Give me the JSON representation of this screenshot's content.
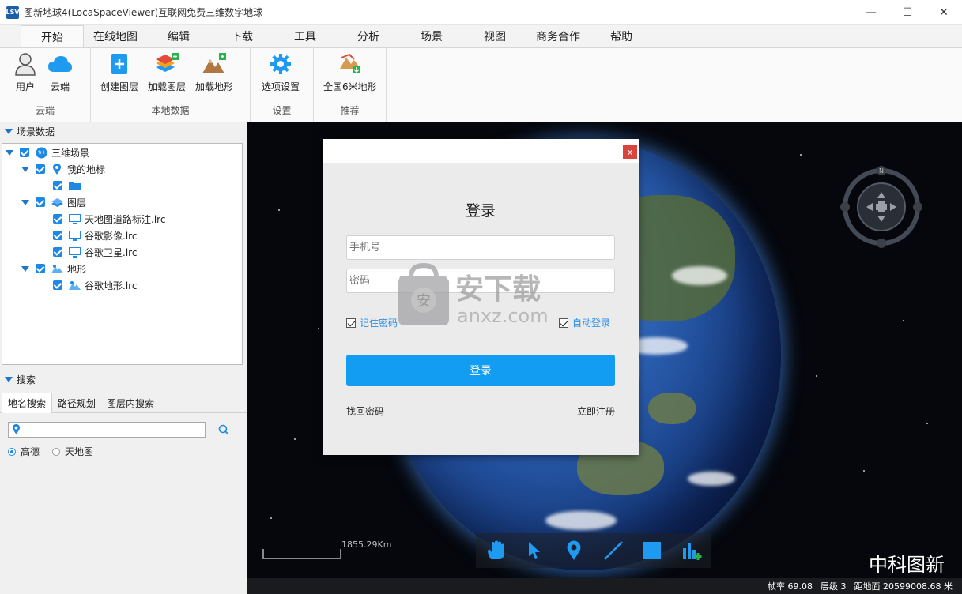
{
  "window": {
    "title": "图新地球4(LocaSpaceViewer)互联网免费三维数字地球",
    "app_icon_text": "LSV",
    "minimize": "—",
    "maximize": "☐",
    "close": "✕"
  },
  "menu": {
    "tabs": [
      "开始",
      "在线地图",
      "编辑",
      "下载",
      "工具",
      "分析",
      "场景",
      "视图",
      "商务合作",
      "帮助"
    ],
    "active": "开始"
  },
  "ribbon": {
    "groups": [
      {
        "label": "云端",
        "items": [
          {
            "label": "用户",
            "icon": "user-icon"
          },
          {
            "label": "云端",
            "icon": "cloud-icon"
          }
        ]
      },
      {
        "label": "本地数据",
        "items": [
          {
            "label": "创建图层",
            "icon": "create-layer-icon"
          },
          {
            "label": "加载图层",
            "icon": "load-layer-icon"
          },
          {
            "label": "加载地形",
            "icon": "load-terrain-icon"
          }
        ]
      },
      {
        "label": "设置",
        "items": [
          {
            "label": "选项设置",
            "icon": "gear-icon"
          }
        ]
      },
      {
        "label": "推荐",
        "items": [
          {
            "label": "全国6米地形",
            "icon": "terrain-6m-icon"
          }
        ]
      }
    ]
  },
  "scene_panel": {
    "header": "场景数据",
    "tree": [
      {
        "label": "三维场景",
        "icon": "globe-icon",
        "level": 0
      },
      {
        "label": "我的地标",
        "icon": "pin-icon",
        "level": 1
      },
      {
        "label": "",
        "icon": "folder-icon",
        "level": 2
      },
      {
        "label": "图层",
        "icon": "layers-icon",
        "level": 1
      },
      {
        "label": "天地图道路标注.lrc",
        "icon": "monitor-icon",
        "level": 2
      },
      {
        "label": "谷歌影像.lrc",
        "icon": "monitor-icon",
        "level": 2
      },
      {
        "label": "谷歌卫星.lrc",
        "icon": "monitor-icon",
        "level": 2
      },
      {
        "label": "地形",
        "icon": "terrain-icon",
        "level": 1
      },
      {
        "label": "谷歌地形.lrc",
        "icon": "terrain-icon",
        "level": 2
      }
    ]
  },
  "search_panel": {
    "header": "搜索",
    "tabs": [
      "地名搜索",
      "路径规划",
      "图层内搜索"
    ],
    "input_value": "",
    "options": [
      {
        "label": "高德",
        "selected": true
      },
      {
        "label": "天地图",
        "selected": false
      }
    ]
  },
  "map": {
    "scale": "1855.29Km",
    "brand": "中科图新",
    "status": {
      "fps": "帧率 69.08",
      "level": "层级 3",
      "distance": "距地面 20599008.68 米"
    },
    "tools": [
      "hand-icon",
      "pointer-icon",
      "pin-icon",
      "line-icon",
      "square-icon",
      "chart-add-icon"
    ],
    "nav_label": "N"
  },
  "login_dialog": {
    "close": "x",
    "title": "登录",
    "phone_placeholder": "手机号",
    "password_placeholder": "密码",
    "remember": "记住密码",
    "auto_login": "自动登录",
    "login_button": "登录",
    "forgot": "找回密码",
    "register": "立即注册"
  },
  "watermark": {
    "text": "安下载",
    "sub": "anxz.com"
  },
  "colors": {
    "accent": "#1e88e5",
    "login_button": "#129df2",
    "close_button": "#d9453d",
    "map_bg": "#05070c"
  }
}
